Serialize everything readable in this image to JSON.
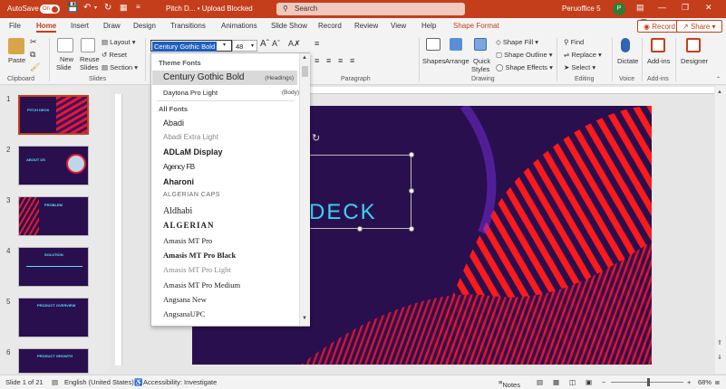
{
  "titlebar": {
    "autosave_label": "AutoSave",
    "autosave_state": "On",
    "doc_title": "Pitch D... • Upload Blocked",
    "search_placeholder": "Search",
    "user_name": "Peruoffice 5",
    "avatar_initial": "P",
    "accent": "#c43e1c"
  },
  "tabs": [
    "File",
    "Home",
    "Insert",
    "Draw",
    "Design",
    "Transitions",
    "Animations",
    "Slide Show",
    "Record",
    "Review",
    "View",
    "Help",
    "Shape Format"
  ],
  "active_tab": "Home",
  "top_buttons": {
    "record": "Record",
    "share": "Share"
  },
  "ribbon": {
    "clipboard": {
      "paste": "Paste",
      "group": "Clipboard"
    },
    "slides": {
      "new_slide_1": "New",
      "new_slide_2": "Slide",
      "reuse_1": "Reuse",
      "reuse_2": "Slides",
      "layout": "Layout",
      "reset": "Reset",
      "section": "Section",
      "group": "Slides"
    },
    "font": {
      "name_value": "Century Gothic Bold",
      "size_value": "48"
    },
    "paragraph": {
      "group": "Paragraph"
    },
    "drawing": {
      "shapes": "Shapes",
      "arrange": "Arrange",
      "quick_1": "Quick",
      "quick_2": "Styles",
      "fill": "Shape Fill",
      "outline": "Shape Outline",
      "effects": "Shape Effects",
      "group": "Drawing"
    },
    "editing": {
      "find": "Find",
      "replace": "Replace",
      "select": "Select",
      "group": "Editing"
    },
    "voice": {
      "dictate": "Dictate",
      "group": "Voice"
    },
    "addins": {
      "label": "Add-ins",
      "group": "Add-ins"
    },
    "designer": {
      "label": "Designer"
    }
  },
  "font_dropdown": {
    "theme_header": "Theme Fonts",
    "theme_fonts": [
      {
        "name": "Century Gothic Bold",
        "note": "(Headings)"
      },
      {
        "name": "Daytona Pro Light",
        "note": "(Body)"
      }
    ],
    "all_header": "All Fonts",
    "all_fonts": [
      {
        "name": "Abadi",
        "cloud": false
      },
      {
        "name": "Abadi Extra Light",
        "cloud": true
      },
      {
        "name": "ADLaM Display",
        "cloud": true
      },
      {
        "name": "Agency FB",
        "cloud": false
      },
      {
        "name": "Aharoni",
        "cloud": false
      },
      {
        "name": "ALGERIAN CAPS",
        "cloud": true
      },
      {
        "name": "Aldhabi",
        "cloud": true
      },
      {
        "name": "ALGERIAN",
        "cloud": false
      },
      {
        "name": "Amasis MT Pro",
        "cloud": true
      },
      {
        "name": "Amasis MT Pro Black",
        "cloud": true
      },
      {
        "name": "Amasis MT Pro Light",
        "cloud": true
      },
      {
        "name": "Amasis MT Pro Medium",
        "cloud": false
      },
      {
        "name": "Angsana New",
        "cloud": true
      },
      {
        "name": "AngsanaUPC",
        "cloud": true
      }
    ]
  },
  "slides": [
    {
      "num": "1",
      "title": "PITCH DECK"
    },
    {
      "num": "2",
      "title": "ABOUT US"
    },
    {
      "num": "3",
      "title": "PROBLEM"
    },
    {
      "num": "4",
      "title": "SOLUTION"
    },
    {
      "num": "5",
      "title": "PRODUCT OVERVIEW"
    },
    {
      "num": "6",
      "title": "PRODUCT GROWTH"
    }
  ],
  "slide_text": "DECK",
  "status": {
    "slide_of": "Slide 1 of 21",
    "language": "English (United States)",
    "accessibility": "Accessibility: Investigate",
    "notes": "Notes",
    "zoom": "68%"
  }
}
